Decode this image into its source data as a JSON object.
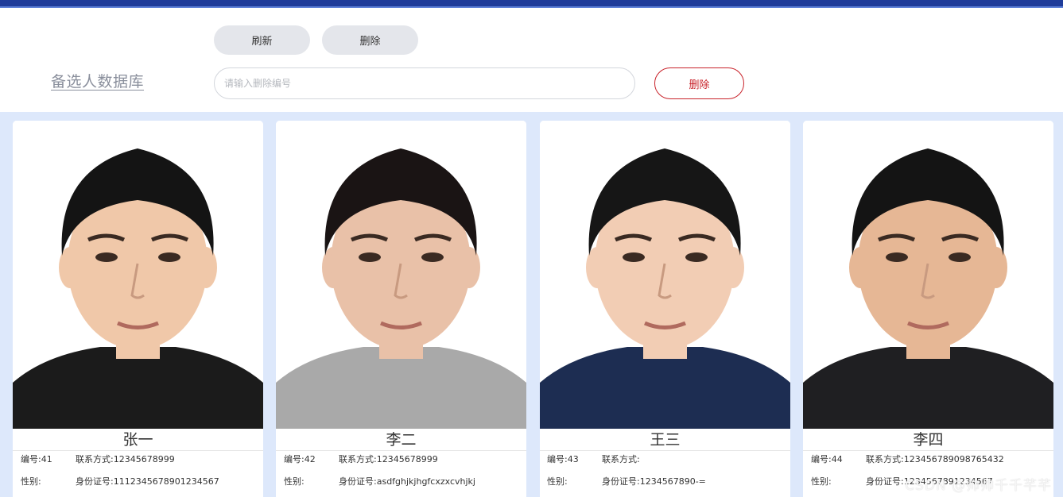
{
  "header": {
    "refresh_label": "刷新",
    "delete_label": "删除",
    "title": "备选人数据库",
    "search_placeholder": "请输入删除编号",
    "delete_red_label": "删除"
  },
  "labels": {
    "id_prefix": "编号:",
    "contact_prefix": "联系方式:",
    "gender_prefix": "性别:",
    "idcard_prefix": "身份证号:"
  },
  "cards": [
    {
      "name": "张一",
      "id": "41",
      "contact": "12345678999",
      "gender": "",
      "idcard": "1112345678901234567",
      "shirt": "#1b1b1b",
      "hair": "#141414",
      "skin": "#f0c8a9"
    },
    {
      "name": "李二",
      "id": "42",
      "contact": "12345678999",
      "gender": "",
      "idcard": "asdfghjkjhgfcxzxcvhjkj",
      "shirt": "#a9a9a9",
      "hair": "#1a1414",
      "skin": "#e9c1a8"
    },
    {
      "name": "王三",
      "id": "43",
      "contact": "",
      "gender": "",
      "idcard": "1234567890-=",
      "shirt": "#1d2d52",
      "hair": "#161616",
      "skin": "#f2cdb4"
    },
    {
      "name": "李四",
      "id": "44",
      "contact": "123456789098765432",
      "gender": "",
      "idcard": "1234567891234567",
      "shirt": "#1f1f22",
      "hair": "#141414",
      "skin": "#e6b795"
    }
  ],
  "watermark": "CSDN @帅帅千千芊芊"
}
